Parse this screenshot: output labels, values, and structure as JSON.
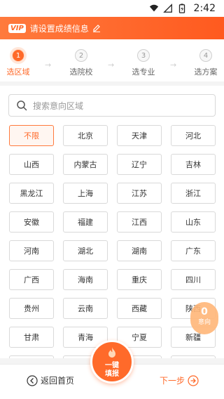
{
  "status_bar": {
    "time": "2:42"
  },
  "vip_banner": {
    "badge": "VIP",
    "text": "请设置成绩信息"
  },
  "steps": [
    {
      "number": "1",
      "label": "选区域",
      "active": true
    },
    {
      "number": "2",
      "label": "选院校",
      "active": false
    },
    {
      "number": "3",
      "label": "选专业",
      "active": false
    },
    {
      "number": "4",
      "label": "选方案",
      "active": false
    }
  ],
  "step_arrow": "→",
  "search": {
    "placeholder": "搜索意向区域"
  },
  "regions": [
    {
      "name": "不限",
      "selected": true
    },
    {
      "name": "北京"
    },
    {
      "name": "天津"
    },
    {
      "name": "河北"
    },
    {
      "name": "山西"
    },
    {
      "name": "内蒙古"
    },
    {
      "name": "辽宁"
    },
    {
      "name": "吉林"
    },
    {
      "name": "黑龙江"
    },
    {
      "name": "上海"
    },
    {
      "name": "江苏"
    },
    {
      "name": "浙江"
    },
    {
      "name": "安徽"
    },
    {
      "name": "福建"
    },
    {
      "name": "江西"
    },
    {
      "name": "山东"
    },
    {
      "name": "河南"
    },
    {
      "name": "湖北"
    },
    {
      "name": "湖南"
    },
    {
      "name": "广东"
    },
    {
      "name": "广西"
    },
    {
      "name": "海南"
    },
    {
      "name": "重庆"
    },
    {
      "name": "四川"
    },
    {
      "name": "贵州"
    },
    {
      "name": "云南"
    },
    {
      "name": "西藏"
    },
    {
      "name": "陕西"
    },
    {
      "name": "甘肃"
    },
    {
      "name": "青海"
    },
    {
      "name": "宁夏"
    },
    {
      "name": "新疆"
    },
    {
      "name": ""
    },
    {
      "name": ""
    },
    {
      "name": ""
    },
    {
      "name": ""
    }
  ],
  "intent": {
    "count": "0",
    "label": "意向"
  },
  "bottom_bar": {
    "back_label": "返回首页",
    "fill_label": "一键填报",
    "next_label": "下一步"
  },
  "colors": {
    "accent": "#ff6a2a",
    "banner_start": "#ff7a3d",
    "banner_end": "#ff5a1f",
    "intent_bg": "#ffb678"
  }
}
